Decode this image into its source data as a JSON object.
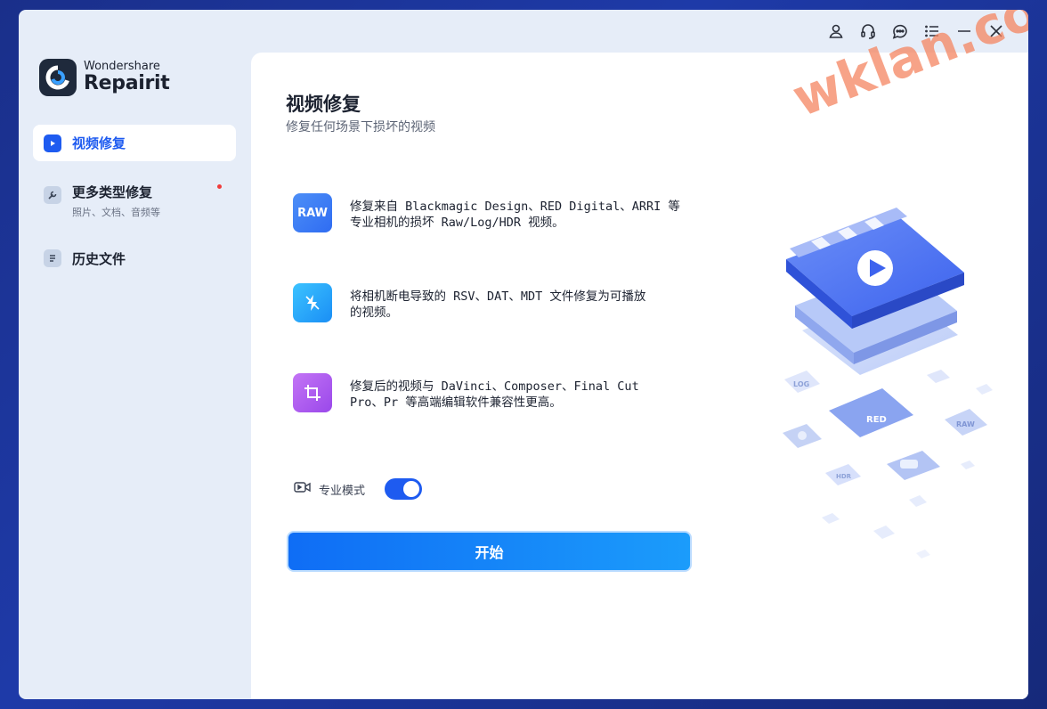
{
  "brand": {
    "company": "Wondershare",
    "product": "Repairit"
  },
  "titlebar": {
    "icons": [
      "user-icon",
      "headset-icon",
      "chat-icon",
      "menu-icon",
      "minimize-icon",
      "close-icon"
    ]
  },
  "sidebar": {
    "items": [
      {
        "label": "视频修复",
        "sub": "",
        "icon": "video-repair-icon",
        "active": true
      },
      {
        "label": "更多类型修复",
        "sub": "照片、文档、音频等",
        "icon": "wrench-icon",
        "active": false,
        "badge": true
      },
      {
        "label": "历史文件",
        "sub": "",
        "icon": "history-file-icon",
        "active": false
      }
    ]
  },
  "main": {
    "title": "视频修复",
    "subtitle": "修复任何场景下损坏的视频",
    "features": [
      {
        "icon_text": "RAW",
        "icon": "raw-icon",
        "line1": "修复来自 Blackmagic Design、RED Digital、ARRI 等",
        "line2": "专业相机的损坏 Raw/Log/HDR 视频。"
      },
      {
        "icon_text": "",
        "icon": "power-flash-icon",
        "line1": "将相机断电导致的 RSV、DAT、MDT 文件修复为可播放",
        "line2": "的视频。"
      },
      {
        "icon_text": "",
        "icon": "crop-icon",
        "line1": "修复后的视频与 DaVinci、Composer、Final Cut",
        "line2": "Pro、Pr 等高端编辑软件兼容性更高。"
      }
    ],
    "pro_mode_label": "专业模式",
    "pro_mode_on": true,
    "start_label": "开始"
  },
  "illustration": {
    "tags": [
      "LOG",
      "RED",
      "RAW",
      "HDR"
    ]
  },
  "watermark": "wklan.com",
  "colors": {
    "accent": "#1e5bf0",
    "sidebar_bg": "#e6edf8",
    "panel_bg": "#ffffff",
    "desktop_bg": "#1e3aa8"
  }
}
